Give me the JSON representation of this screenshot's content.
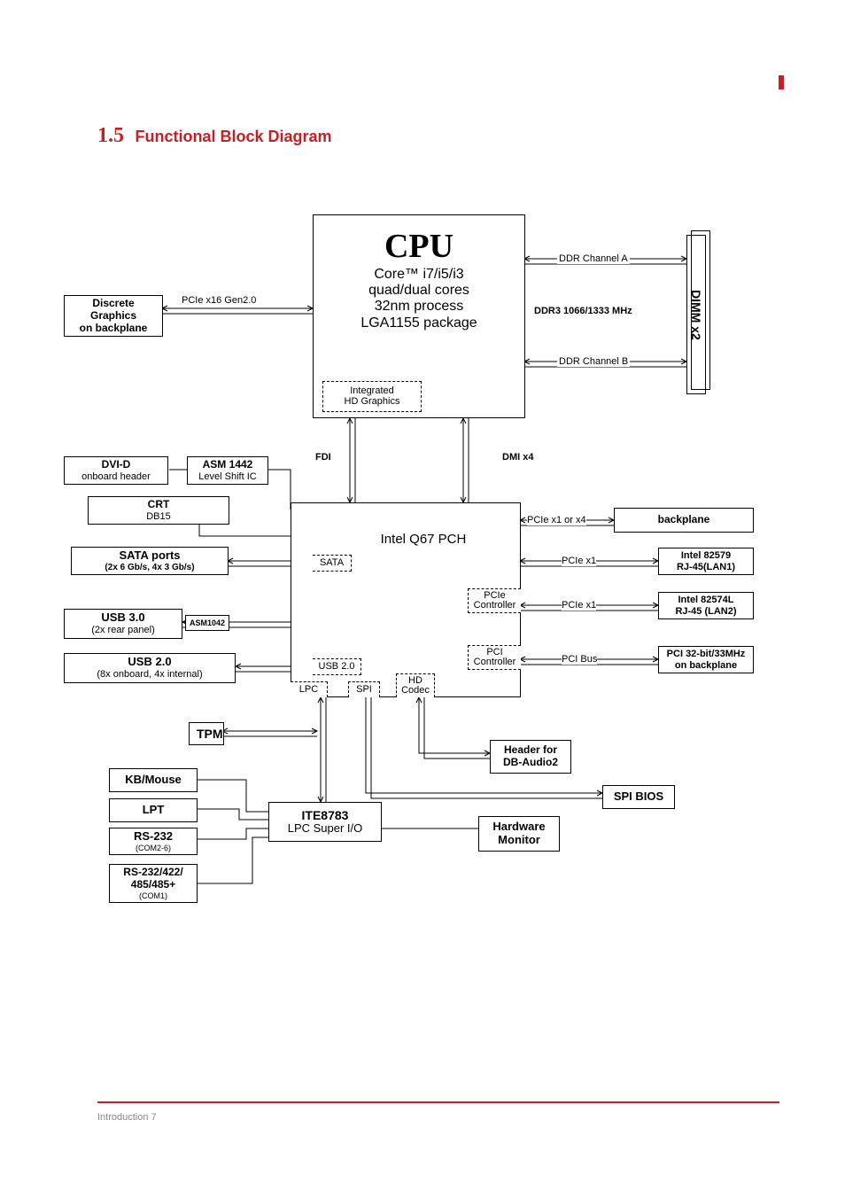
{
  "header": {
    "accent": "red",
    "section_no": "1.5",
    "section_title": "Functional Block Diagram"
  },
  "footer": {
    "text": "Introduction         7"
  },
  "diagram": {
    "cpu": {
      "title": "CPU",
      "line1": "Core™ i7/i5/i3",
      "line2": "quad/dual cores",
      "line3": "32nm process",
      "line4": "LGA1155 package",
      "subbox": {
        "l1": "Integrated",
        "l2": "HD Graphics"
      }
    },
    "dimm": {
      "label": "DIMM x2",
      "ddr_a": "DDR Channel A",
      "ddr_b": "DDR Channel B",
      "spec": "DDR3 1066/1333 MHz"
    },
    "discrete_gfx": {
      "l1": "Discrete Graphics",
      "l2": "on backplane"
    },
    "pcie16": "PCIe x16 Gen2.0",
    "fdi": "FDI",
    "dmi": "DMI x4",
    "dvi": {
      "l1": "DVI-D",
      "l2": "onboard header"
    },
    "asm1442": {
      "l1": "ASM 1442",
      "l2": "Level Shift IC"
    },
    "crt": {
      "l1": "CRT",
      "l2": "DB15"
    },
    "pch": {
      "title": "Intel Q67 PCH",
      "sata": "SATA",
      "pcie": "PCIe Controller",
      "pci": "PCI Controller",
      "usb2": "USB 2.0",
      "lpc": "LPC",
      "spi": "SPI",
      "hd": "HD Codec"
    },
    "sata_ports": {
      "l1": "SATA ports",
      "l2": "(2x 6 Gb/s, 4x 3 Gb/s)"
    },
    "usb30": {
      "l1": "USB 3.0",
      "l2": "(2x rear panel)"
    },
    "asm1042": "ASM1042",
    "usb20": {
      "l1": "USB 2.0",
      "l2": "(8x onboard, 4x internal)"
    },
    "backplane": "backplane",
    "pcie_x1x4": "PCIe x1 or x4",
    "lan1": {
      "l1": "Intel 82579",
      "l2": "RJ-45(LAN1)"
    },
    "pcie_x1a": "PCIe x1",
    "lan2": {
      "l1": "Intel 82574L",
      "l2": "RJ-45 (LAN2)"
    },
    "pcie_x1b": "PCIe x1",
    "pci32": {
      "l1": "PCI 32-bit/33MHz",
      "l2": "on backplane"
    },
    "pci_bus": "PCI Bus",
    "tpm": "TPM",
    "kbm": "KB/Mouse",
    "lpt": "LPT",
    "rs232": {
      "l1": "RS-232",
      "l2": "(COM2-6)"
    },
    "rs232_485": {
      "l1": "RS-232/422/",
      "l2": "485/485+",
      "l3": "(COM1)"
    },
    "ite": {
      "l1": "ITE8783",
      "l2": "LPC Super I/O"
    },
    "hwmon": {
      "l1": "Hardware",
      "l2": "Monitor"
    },
    "spibios": "SPI BIOS",
    "dbaudio": {
      "l1": "Header for",
      "l2": "DB-Audio2"
    }
  }
}
